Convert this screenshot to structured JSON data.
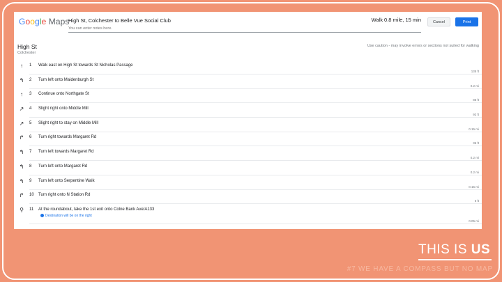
{
  "logo": {
    "text": "Google Maps",
    "colors": [
      "#4285f4",
      "#ea4335",
      "#fbbc05",
      "#4285f4",
      "#34a853",
      "#ea4335"
    ]
  },
  "header": {
    "route_title": "High St, Colchester to Belle Vue Social Club",
    "notes_placeholder": "You can enter notes here.",
    "summary": "Walk 0.8 mile, 15 min",
    "cancel_label": "Cancel",
    "print_label": "Print"
  },
  "origin": {
    "name": "High St",
    "locality": "Colchester"
  },
  "caution_text": "Use caution - may involve errors or sections not suited for walking",
  "steps": [
    {
      "num": "1",
      "text": "Walk east on High St towards St Nicholas Passage",
      "dist": "135 ft",
      "icon": "straight-arrow-icon",
      "glyph": "↑"
    },
    {
      "num": "2",
      "text": "Turn left onto Maidenburgh St",
      "dist": "0.2 mi",
      "icon": "turn-left-icon",
      "glyph": "↰"
    },
    {
      "num": "3",
      "text": "Continue onto Northgate St",
      "dist": "85 ft",
      "icon": "straight-arrow-icon",
      "glyph": "↑"
    },
    {
      "num": "4",
      "text": "Slight right onto Middle Mill",
      "dist": "92 ft",
      "icon": "slight-right-icon",
      "glyph": "↗"
    },
    {
      "num": "5",
      "text": "Slight right to stay on Middle Mill",
      "dist": "0.15 mi",
      "icon": "slight-right-icon",
      "glyph": "↗"
    },
    {
      "num": "6",
      "text": "Turn right towards Margaret Rd",
      "dist": "36 ft",
      "icon": "turn-right-icon",
      "glyph": "↱"
    },
    {
      "num": "7",
      "text": "Turn left towards Margaret Rd",
      "dist": "0.2 mi",
      "icon": "turn-left-icon",
      "glyph": "↰"
    },
    {
      "num": "8",
      "text": "Turn left onto Margaret Rd",
      "dist": "0.2 mi",
      "icon": "turn-left-icon",
      "glyph": "↰"
    },
    {
      "num": "9",
      "text": "Turn left onto Serpentine Walk",
      "dist": "0.15 mi",
      "icon": "turn-left-icon",
      "glyph": "↰"
    },
    {
      "num": "10",
      "text": "Turn right onto N Station Rd",
      "dist": "6 ft",
      "icon": "turn-right-icon",
      "glyph": "↱"
    },
    {
      "num": "11",
      "text": "At the roundabout, take the 1st exit onto Colne Bank Ave/A133",
      "dist": "0.05 mi",
      "icon": "destination-pin-icon",
      "glyph": "⚲",
      "note": "Destination will be on the right"
    }
  ],
  "tagline": {
    "main_prefix": "THIS IS ",
    "main_bold": "US",
    "sub": "#7 WE HAVE A COMPASS BUT NO MAP"
  }
}
